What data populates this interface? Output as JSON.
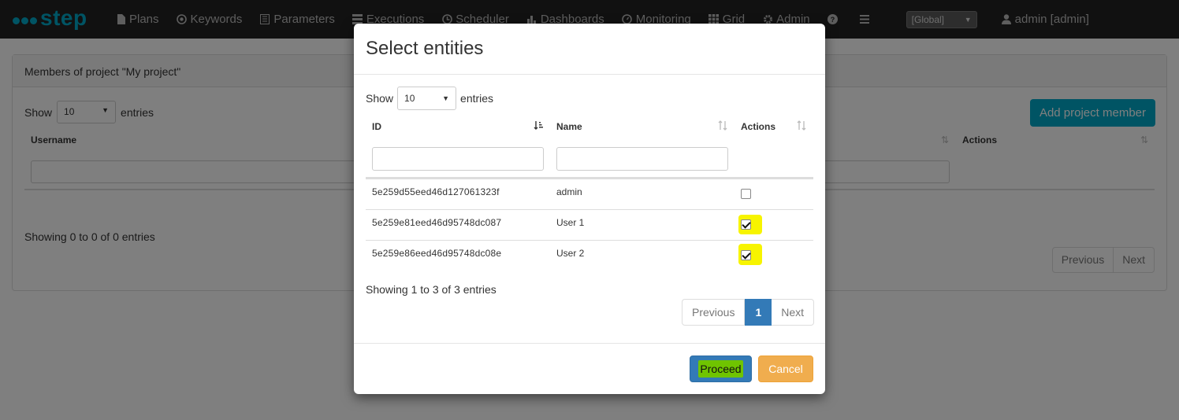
{
  "navbar": {
    "brand": "step",
    "items": [
      {
        "label": "Plans",
        "icon": "file-icon"
      },
      {
        "label": "Keywords",
        "icon": "target-icon"
      },
      {
        "label": "Parameters",
        "icon": "list-icon"
      },
      {
        "label": "Executions",
        "icon": "tasks-icon"
      },
      {
        "label": "Scheduler",
        "icon": "clock-icon"
      },
      {
        "label": "Dashboards",
        "icon": "bar-chart-icon"
      },
      {
        "label": "Monitoring",
        "icon": "dashboard-icon"
      },
      {
        "label": "Grid",
        "icon": "grid-icon"
      },
      {
        "label": "Admin",
        "icon": "gear-icon"
      }
    ],
    "context_select": "[Global]",
    "user_label": "admin [admin]"
  },
  "background": {
    "panel_title": "Members of project \"My project\"",
    "show_label": "Show",
    "show_value": "10",
    "entries_label": "entries",
    "add_button": "Add project member",
    "columns": {
      "username": "Username",
      "actions": "Actions"
    },
    "info": "Showing 0 to 0 of 0 entries",
    "pager": {
      "previous": "Previous",
      "next": "Next"
    }
  },
  "modal": {
    "title": "Select entities",
    "show_label": "Show",
    "show_value": "10",
    "entries_label": "entries",
    "columns": {
      "id": "ID",
      "name": "Name",
      "actions": "Actions"
    },
    "rows": [
      {
        "id": "5e259d55eed46d127061323f",
        "name": "admin",
        "checked": false
      },
      {
        "id": "5e259e81eed46d95748dc087",
        "name": "User 1",
        "checked": true
      },
      {
        "id": "5e259e86eed46d95748dc08e",
        "name": "User 2",
        "checked": true
      }
    ],
    "info": "Showing 1 to 3 of 3 entries",
    "pager": {
      "previous": "Previous",
      "current": "1",
      "next": "Next"
    },
    "proceed_label": "Proceed",
    "cancel_label": "Cancel"
  },
  "colors": {
    "brand": "#00a9c8",
    "primary": "#337ab7",
    "warning": "#f0ad4e",
    "highlight_yellow": "#f7f400",
    "highlight_green": "#6fc400"
  }
}
